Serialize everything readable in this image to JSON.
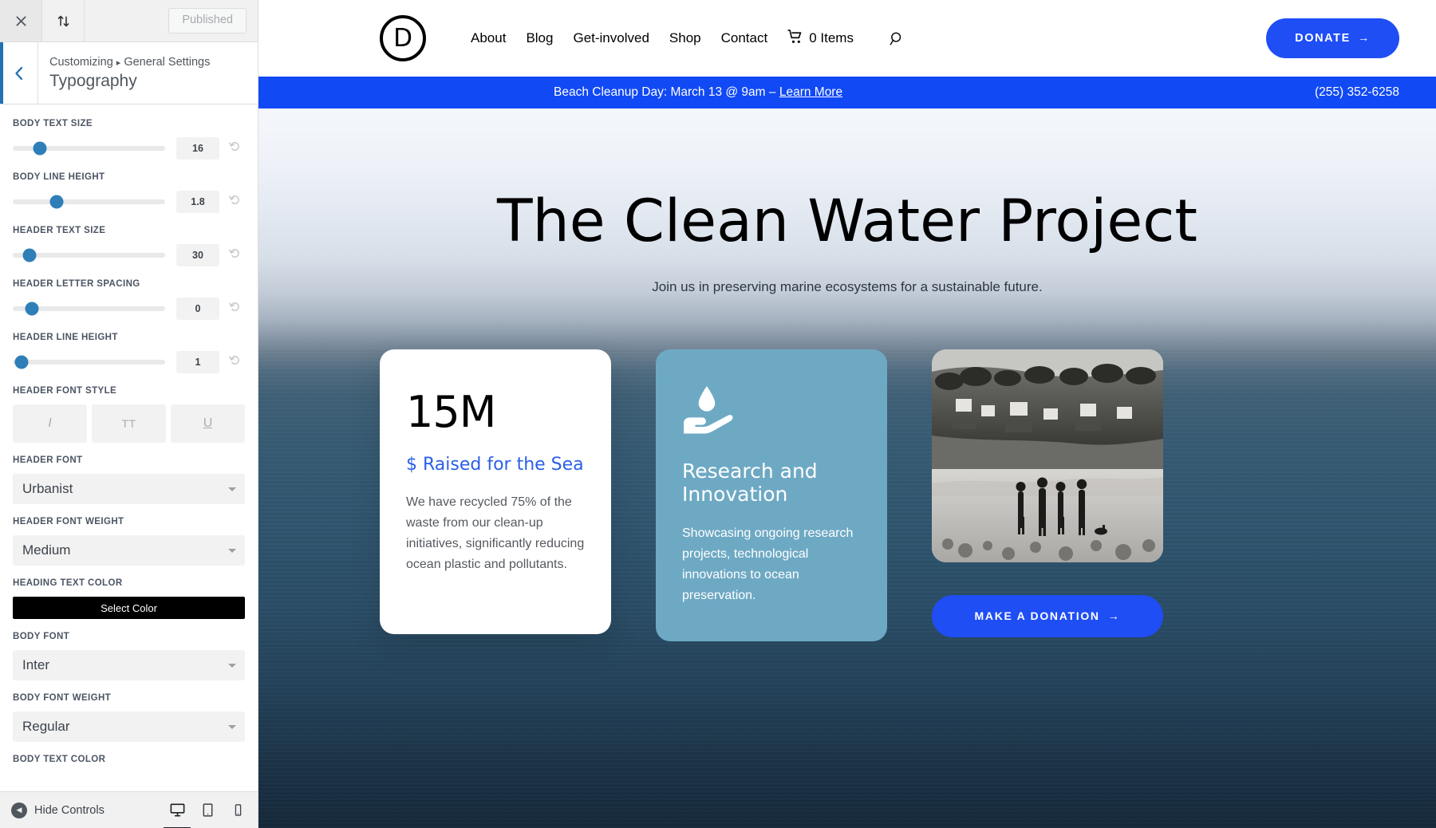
{
  "customizer": {
    "topbar": {
      "close_icon": "close-icon",
      "devices_icon": "collapse-icon",
      "published_label": "Published"
    },
    "header": {
      "back_icon": "chevron-left-icon",
      "breadcrumb_root": "Customizing",
      "breadcrumb_sep": "▸",
      "breadcrumb_section": "General Settings",
      "panel_title": "Typography"
    },
    "controls": [
      {
        "type": "slider",
        "label": "Body Text Size",
        "value": "16",
        "percent": 18,
        "reset_icon": "reset-icon"
      },
      {
        "type": "slider",
        "label": "Body Line Height",
        "value": "1.8",
        "percent": 28,
        "reset_icon": "reset-icon"
      },
      {
        "type": "slider",
        "label": "Header Text Size",
        "value": "30",
        "percent": 11,
        "reset_icon": "reset-icon"
      },
      {
        "type": "slider",
        "label": "Header Letter Spacing",
        "value": "0",
        "percent": 12,
        "reset_icon": "reset-icon"
      },
      {
        "type": "slider",
        "label": "Header Line Height",
        "value": "1",
        "percent": 6,
        "reset_icon": "reset-icon"
      }
    ],
    "font_style": {
      "label": "Header Font Style",
      "buttons": [
        {
          "name": "italic",
          "glyph": "I"
        },
        {
          "name": "uppercase",
          "glyph": "TT"
        },
        {
          "name": "underline",
          "glyph": "U"
        }
      ]
    },
    "header_font": {
      "label": "Header Font",
      "value": "Urbanist"
    },
    "header_font_weight": {
      "label": "Header Font Weight",
      "value": "Medium"
    },
    "heading_text_color": {
      "label": "Heading Text Color",
      "button": "Select Color",
      "swatch": "#000000"
    },
    "body_font": {
      "label": "Body Font",
      "value": "Inter"
    },
    "body_font_weight": {
      "label": "Body Font Weight",
      "value": "Regular"
    },
    "body_text_color": {
      "label": "Body Text Color"
    },
    "footer": {
      "hide_controls_label": "Hide Controls",
      "hide_icon": "caret-left-circle-icon",
      "devices": [
        {
          "name": "desktop-view",
          "active": true
        },
        {
          "name": "tablet-view",
          "active": false
        },
        {
          "name": "mobile-view",
          "active": false
        }
      ]
    }
  },
  "site": {
    "logo_letter": "D",
    "nav": [
      {
        "label": "About"
      },
      {
        "label": "Blog"
      },
      {
        "label": "Get-involved"
      },
      {
        "label": "Shop"
      },
      {
        "label": "Contact"
      }
    ],
    "cart": {
      "icon": "cart-icon",
      "label": "0 Items"
    },
    "search_icon": "search-icon",
    "donate_button": {
      "label": "DONATE",
      "arrow": "→",
      "color": "#1f4ef5"
    },
    "announcement": {
      "text": "Beach Cleanup Day: March 13 @ 9am – ",
      "link": "Learn More",
      "phone": "(255) 352-6258",
      "bg": "#1149f5"
    },
    "hero": {
      "title": "The Clean Water Project",
      "subtitle": "Join us in preserving marine ecosystems for a sustainable future."
    },
    "cards": [
      {
        "type": "stat",
        "number": "15M",
        "label": "$ Raised for the Sea",
        "label_color": "#2b5fe8",
        "body": "We have recycled 75% of the waste from our clean-up initiatives, significantly reducing ocean plastic and pollutants."
      },
      {
        "type": "feature",
        "icon": "hand-holding-water-drop-icon",
        "bg": "#6ea9c4",
        "title": "Research and Innovation",
        "body": "Showcasing ongoing research projects, technological innovations to ocean preservation."
      },
      {
        "type": "image",
        "image_alt": "people-on-beach-photo",
        "cta_label": "MAKE A DONATION",
        "cta_arrow": "→"
      }
    ]
  }
}
